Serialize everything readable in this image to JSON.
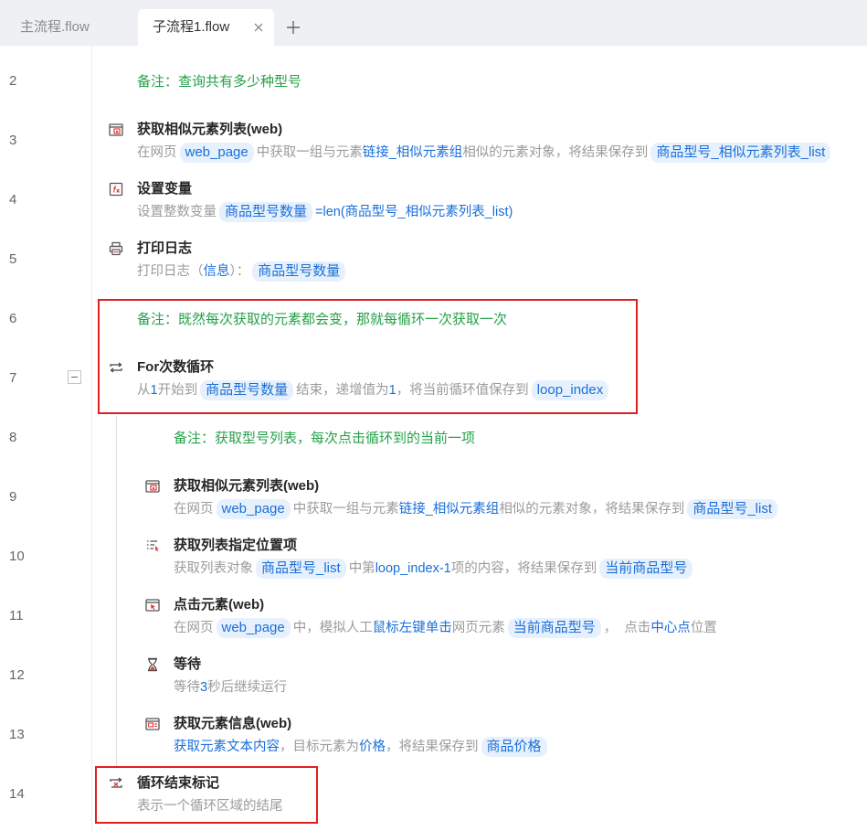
{
  "tabs": [
    {
      "label": "主流程.flow",
      "active": false
    },
    {
      "label": "子流程1.flow",
      "active": true
    }
  ],
  "colors": {
    "comment": "#24a148",
    "link": "#1a6fd8",
    "pill_bg": "#e7f1fd",
    "muted": "#9b9b9b",
    "title": "#262626",
    "annotation": "#e02020"
  },
  "steps": [
    {
      "line": "2",
      "kind": "comment",
      "level": 0,
      "text": "备注：查询共有多少种型号"
    },
    {
      "line": "3",
      "kind": "action",
      "level": 0,
      "icon": "browser-elements-icon",
      "title": "获取相似元素列表(web)",
      "desc": [
        {
          "t": "在网页",
          "s": "plain"
        },
        {
          "t": "web_page",
          "s": "var"
        },
        {
          "t": "中获取一组与元素",
          "s": "plain"
        },
        {
          "t": "链接_相似元素组",
          "s": "link"
        },
        {
          "t": "相似的元素对象，将结果保存到",
          "s": "plain"
        },
        {
          "t": "商品型号_相似元素列表_list",
          "s": "var"
        }
      ]
    },
    {
      "line": "4",
      "kind": "action",
      "level": 0,
      "icon": "set-variable-icon",
      "title": "设置变量",
      "desc": [
        {
          "t": "设置整数变量",
          "s": "plain"
        },
        {
          "t": "商品型号数量",
          "s": "var"
        },
        {
          "t": "=len(商品型号_相似元素列表_list)",
          "s": "link"
        }
      ]
    },
    {
      "line": "5",
      "kind": "action",
      "level": 0,
      "icon": "printer-icon",
      "title": "打印日志",
      "desc": [
        {
          "t": "打印日志（",
          "s": "plain"
        },
        {
          "t": "信息",
          "s": "link"
        },
        {
          "t": "）：",
          "s": "plain"
        },
        {
          "t": "商品型号数量",
          "s": "var"
        }
      ]
    },
    {
      "line": "6",
      "kind": "comment",
      "level": 0,
      "text": "备注：既然每次获取的元素都会变，那就每循环一次获取一次"
    },
    {
      "line": "7",
      "kind": "action",
      "level": 0,
      "icon": "loop-icon",
      "title": "For次数循环",
      "collapsible": true,
      "desc": [
        {
          "t": "从",
          "s": "plain"
        },
        {
          "t": "1",
          "s": "link"
        },
        {
          "t": "开始到",
          "s": "plain"
        },
        {
          "t": "商品型号数量",
          "s": "var"
        },
        {
          "t": "结束，递增值为",
          "s": "plain"
        },
        {
          "t": "1",
          "s": "link"
        },
        {
          "t": "，将当前循环值保存到",
          "s": "plain"
        },
        {
          "t": "loop_index",
          "s": "var"
        }
      ]
    },
    {
      "line": "8",
      "kind": "comment",
      "level": 1,
      "text": "备注：获取型号列表，每次点击循环到的当前一项"
    },
    {
      "line": "9",
      "kind": "action",
      "level": 1,
      "icon": "browser-elements-icon",
      "title": "获取相似元素列表(web)",
      "desc": [
        {
          "t": "在网页",
          "s": "plain"
        },
        {
          "t": "web_page",
          "s": "var"
        },
        {
          "t": "中获取一组与元素",
          "s": "plain"
        },
        {
          "t": "链接_相似元素组",
          "s": "link"
        },
        {
          "t": "相似的元素对象，将结果保存到",
          "s": "plain"
        },
        {
          "t": "商品型号_list",
          "s": "var"
        }
      ]
    },
    {
      "line": "10",
      "kind": "action",
      "level": 1,
      "icon": "list-item-icon",
      "title": "获取列表指定位置项",
      "desc": [
        {
          "t": "获取列表对象",
          "s": "plain"
        },
        {
          "t": "商品型号_list",
          "s": "var"
        },
        {
          "t": "中第",
          "s": "plain"
        },
        {
          "t": "loop_index-1",
          "s": "link"
        },
        {
          "t": "项的内容，将结果保存到",
          "s": "plain"
        },
        {
          "t": "当前商品型号",
          "s": "var"
        }
      ]
    },
    {
      "line": "11",
      "kind": "action",
      "level": 1,
      "icon": "click-element-icon",
      "title": "点击元素(web)",
      "desc": [
        {
          "t": "在网页",
          "s": "plain"
        },
        {
          "t": "web_page",
          "s": "var"
        },
        {
          "t": "中，模拟人工",
          "s": "plain"
        },
        {
          "t": "鼠标左键单击",
          "s": "link"
        },
        {
          "t": "网页元素",
          "s": "plain"
        },
        {
          "t": "当前商品型号",
          "s": "var"
        },
        {
          "t": "，  点击",
          "s": "plain"
        },
        {
          "t": "中心点",
          "s": "link"
        },
        {
          "t": "位置",
          "s": "plain"
        }
      ]
    },
    {
      "line": "12",
      "kind": "action",
      "level": 1,
      "icon": "hourglass-icon",
      "title": "等待",
      "desc": [
        {
          "t": "等待",
          "s": "plain"
        },
        {
          "t": "3",
          "s": "link"
        },
        {
          "t": "秒后继续运行",
          "s": "plain"
        }
      ]
    },
    {
      "line": "13",
      "kind": "action",
      "level": 1,
      "icon": "element-info-icon",
      "title": "获取元素信息(web)",
      "desc": [
        {
          "t": "获取元素文本内容",
          "s": "link"
        },
        {
          "t": "，目标元素为",
          "s": "plain"
        },
        {
          "t": "价格",
          "s": "link"
        },
        {
          "t": "，将结果保存到",
          "s": "plain"
        },
        {
          "t": "商品价格",
          "s": "var"
        }
      ]
    },
    {
      "line": "14",
      "kind": "action",
      "level": 0,
      "icon": "loop-end-icon",
      "title": "循环结束标记",
      "desc": [
        {
          "t": "表示一个循环区域的结尾",
          "s": "plain"
        }
      ]
    }
  ]
}
